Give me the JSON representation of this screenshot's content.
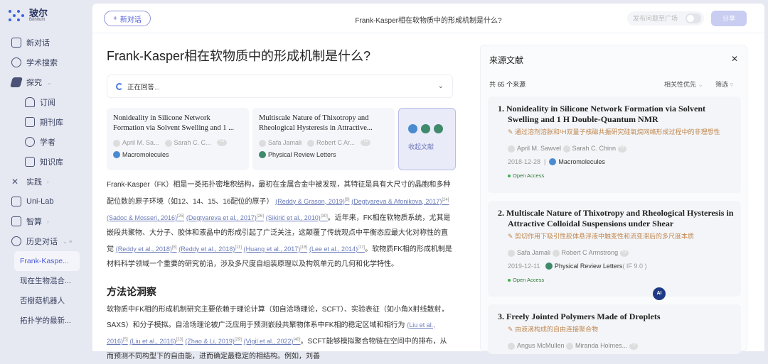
{
  "sidebar": {
    "logo": "玻尔",
    "logo_sub": "Bohrium",
    "items": [
      {
        "label": "新对话"
      },
      {
        "label": "学术搜索"
      },
      {
        "label": "探究"
      },
      {
        "label": "订阅"
      },
      {
        "label": "期刊库"
      },
      {
        "label": "学者"
      },
      {
        "label": "知识库"
      },
      {
        "label": "实践"
      },
      {
        "label": "Uni-Lab"
      },
      {
        "label": "智算"
      },
      {
        "label": "历史对话"
      }
    ],
    "history": [
      "Frank-Kaspe...",
      "现在生物混合...",
      "否樹菇机器人",
      "拓扑学的最新..."
    ]
  },
  "header": {
    "new_chat": "新对话",
    "title": "Frank-Kasper相在软物质中的形成机制是什么?",
    "publish": "发布问题至广场",
    "share": "分享"
  },
  "question": "Frank-Kasper相在软物质中的形成机制是什么?",
  "status": "正在回答...",
  "cards": [
    {
      "title": "Nonideality in Silicone Network Formation via Solvent Swelling and 1 ...",
      "authors": [
        "April M. Sa...",
        "Sarah C. C..."
      ],
      "more": "+3",
      "journal": "Macromolecules"
    },
    {
      "title": "Multiscale Nature of Thixotropy and Rheological Hysteresis in Attractive...",
      "authors": [
        "Safa Jamali",
        "Robert C Ar..."
      ],
      "more": "+1",
      "journal": "Physical Review Letters"
    }
  ],
  "collect_label": "收起文献",
  "para1": {
    "t1": "Frank-Kasper（FK）相是一类拓扑密堆积结构，最初在金属合金中被发现，其特征是具有大尺寸的晶胞和多种配位数的原子环境（如12、14、15、16配位的原子）",
    "c1": "(Reddy & Grason, 2019)",
    "n1": "[9]",
    "c2": "(Degtyareva & Afonikova, 2017)",
    "n2": "[24]",
    "c3": "(Sadoc & Mosseri, 2016)",
    "n3": "[25]",
    "c4": "(Degtyareva et al., 2017)",
    "n4": "[26]",
    "c5": "(Sikirić et al., 2010)",
    "n5": "[30]",
    "t2": "。近年来，FK相在软物质系统，尤其是嵌段共聚物、大分子、胶体和液晶中的形成引起了广泛关注，这颠覆了传统观点中平衡态应最大化对称性的直觉",
    "c6": "(Reddy et al., 2018)",
    "n6": "[8]",
    "c7": "(Reddy et al., 2018)",
    "n7": "[11]",
    "c8": "(Huang et al., 2017)",
    "n8": "[16]",
    "c9": "(Lee et al., 2014)",
    "n9": "[17]",
    "t3": "。软物质FK相的形成机制是材料科学领域一个重要的研究前沿，涉及多尺度自组装原理以及构筑单元的几何和化学特性。"
  },
  "section": "方法论洞察",
  "para2": {
    "t1": "软物质中FK相的形成机制研究主要依赖于理论计算（如自洽场理论，SCFT）、实验表征（如小角X射线散射，SAXS）和分子模拟。自洽场理论被广泛应用于预测嵌段共聚物体系中FK相的稳定区域和相行为",
    "c1": "(Liu et al., 2016)",
    "n1": "[5]",
    "c2": "(Liu et al., 2016)",
    "n2": "[23]",
    "c3": "(Zhao & Li, 2019)",
    "n3": "[29]",
    "c4": "(Vigil et al., 2022)",
    "n4": "[40]",
    "t2": "。SCFT能够模拟聚合物链在空间中的排布，从而预测不同构型下的自由能，进而确定最稳定的相结构。例如，刘善"
  },
  "panel": {
    "title": "来源文献",
    "count": "共 65 个来源",
    "sort": "相关性优先",
    "filter": "筛选",
    "sources": [
      {
        "num": "1.",
        "title": "Nonideality in Silicone Network Formation via Solvent Swelling and 1 H Double-Quantum NMR",
        "translation": "通过溶剂溶胀和¹H双量子核磁共振研究硅氧烷网络形成过程中的非理想性",
        "authors": [
          "April M. Sawvel",
          "Sarah C. Chinn"
        ],
        "more": "+3",
        "date": "2018-12-28",
        "journal": "Macromolecules",
        "oa": "Open Access"
      },
      {
        "num": "2.",
        "title": "Multiscale Nature of Thixotropy and Rheological Hysteresis in Attractive Colloidal Suspensions under Shear",
        "translation": "剪切作用下吸引性胶体悬浮液中触变性和流变滞后的多尺度本质",
        "authors": [
          "Safa Jamali",
          "Robert C Armstrong"
        ],
        "more": "+1",
        "date": "2019-12-11",
        "journal": "Physical Review Letters",
        "if": "( IF 9.0 )",
        "oa": "Open Access"
      },
      {
        "num": "3.",
        "title": "Freely Jointed Polymers Made of Droplets",
        "translation": "由液滴构成的自由连接聚合物",
        "authors": [
          "Angus McMullen",
          "Miranda Holmes..."
        ],
        "more": "+2"
      }
    ]
  },
  "ai_badge": "AI",
  "colors": {
    "accent": "#4c5bd4",
    "sidebar_bg": "#e6e9f2",
    "share_bg": "#c8cdf1",
    "translation": "#c08850",
    "oa_dot": "#3cb04a"
  }
}
